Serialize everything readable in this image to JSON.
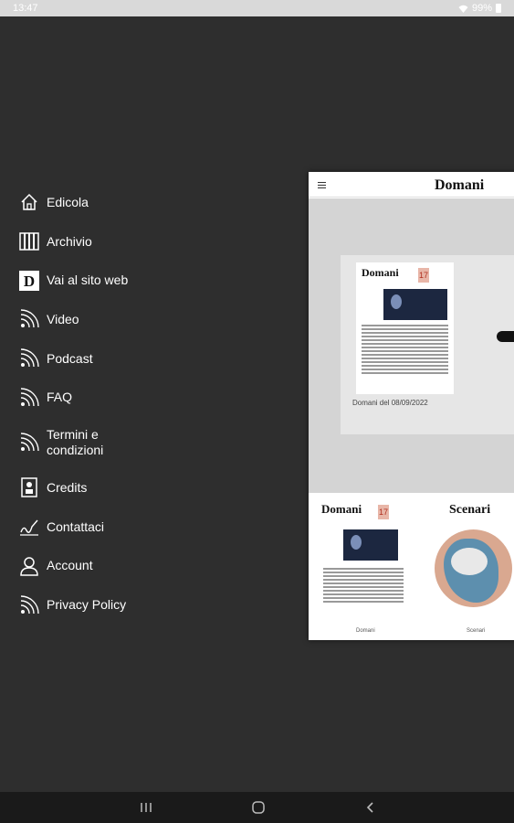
{
  "status_bar": {
    "time": "13:47",
    "battery": "99%"
  },
  "menu": {
    "items": [
      {
        "label": "Edicola",
        "icon": "home-icon"
      },
      {
        "label": "Archivio",
        "icon": "archive-icon"
      },
      {
        "label": "Vai al sito web",
        "icon": "domani-d-icon"
      },
      {
        "label": "Video",
        "icon": "rss-icon"
      },
      {
        "label": "Podcast",
        "icon": "rss-icon"
      },
      {
        "label": "FAQ",
        "icon": "rss-icon"
      },
      {
        "label_line1": "Termini e",
        "label_line2": "condizioni",
        "icon": "rss-icon"
      },
      {
        "label": "Credits",
        "icon": "badge-icon"
      },
      {
        "label": "Contattaci",
        "icon": "signature-icon"
      },
      {
        "label": "Account",
        "icon": "user-icon"
      },
      {
        "label": "Privacy Policy",
        "icon": "rss-icon"
      }
    ]
  },
  "preview": {
    "brand": "Domani",
    "featured_caption": "Domani del 08/09/2022",
    "issue_title": "Domani",
    "issue_number": "17",
    "thumbs": [
      {
        "title": "Domani",
        "label": "Domani"
      },
      {
        "title": "Scenari",
        "label": "Scenari"
      }
    ]
  },
  "colors": {
    "background": "#2e2e2e",
    "nav_bar": "#1a1a1a",
    "status_bar": "#d9d9d9"
  }
}
